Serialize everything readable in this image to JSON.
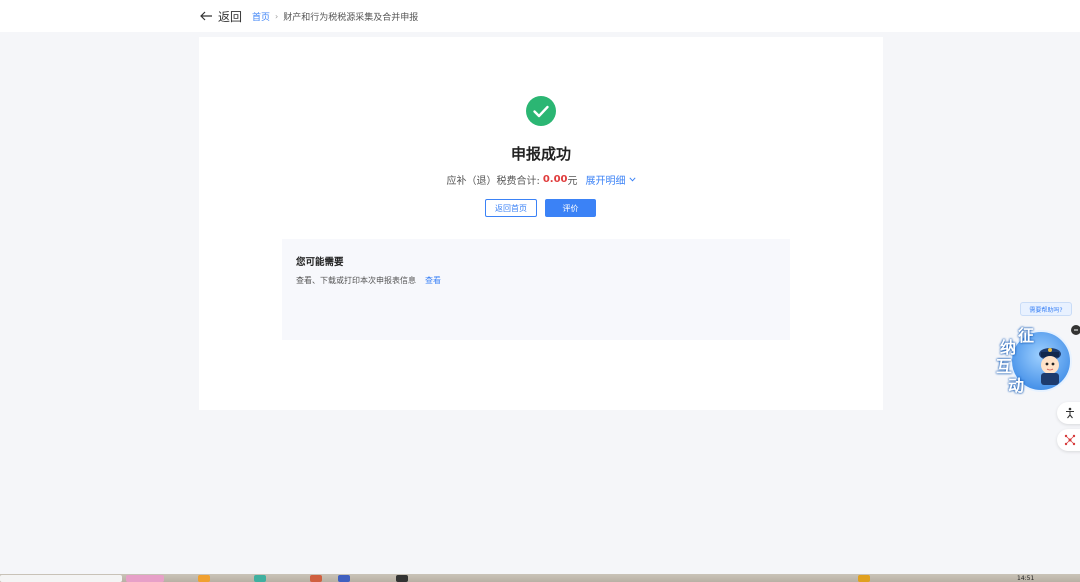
{
  "header": {
    "back_label": "返回",
    "breadcrumb_home": "首页",
    "breadcrumb_separator": "›",
    "breadcrumb_current": "财产和行为税税源采集及合并申报"
  },
  "result": {
    "title": "申报成功",
    "amount_label": "应补（退）税费合计:",
    "amount_value": "0.00",
    "amount_unit": "元",
    "expand_label": "展开明细",
    "home_button": "返回首页",
    "rate_button": "评价"
  },
  "suggest": {
    "title": "您可能需要",
    "row_text": "查看、下载或打印本次申报表信息",
    "row_link": "查看"
  },
  "assistant": {
    "bubble": "需要帮助吗?",
    "chars": [
      "征",
      "纳",
      "互",
      "动"
    ]
  },
  "taskbar": {
    "clock": "14:51"
  },
  "colors": {
    "primary": "#3b82f6",
    "success": "#2bb673",
    "amount": "#e03c3c",
    "background": "#f5f6f9"
  }
}
